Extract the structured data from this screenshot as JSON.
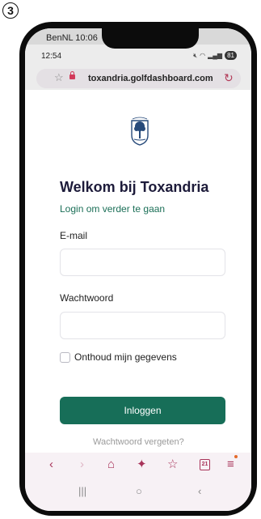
{
  "step_number": "3",
  "status_bar": {
    "ios_carrier_time": "BenNL 10:06",
    "android_time": "12:54",
    "battery_level": "81"
  },
  "browser": {
    "url": "toxandria.golfdashboard.com"
  },
  "login": {
    "title": "Welkom bij Toxandria",
    "subtitle": "Login om verder te gaan",
    "email_label": "E-mail",
    "email_value": "",
    "password_label": "Wachtwoord",
    "password_value": "",
    "remember_label": "Onthoud mijn gegevens",
    "remember_checked": false,
    "submit_label": "Inloggen",
    "forgot_label": "Wachtwoord vergeten?"
  },
  "bottom_nav": {
    "back_icon": "back-arrow-icon",
    "forward_icon": "forward-arrow-icon",
    "home_icon": "home-icon",
    "extension_icon": "sparkle-icon",
    "bookmark_icon": "star-icon",
    "tabs_count": "21",
    "menu_icon": "hamburger-menu-icon"
  },
  "system_nav": {
    "recents_icon": "recents-icon",
    "home_icon": "circle-home-icon",
    "back_icon": "back-chevron-icon"
  },
  "colors": {
    "accent": "#176e58",
    "heading": "#1d1b3a",
    "browser_accent": "#a8345a"
  }
}
